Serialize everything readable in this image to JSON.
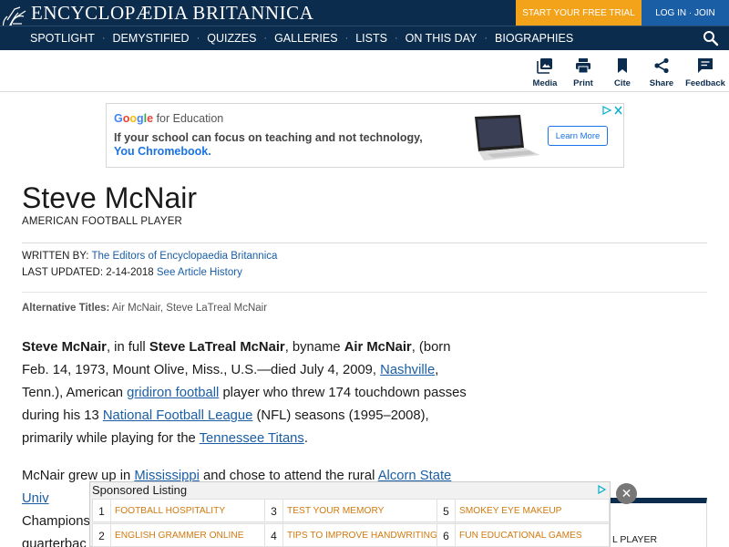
{
  "header": {
    "logo_text": "ENCYCLOPÆDIA BRITANNICA",
    "trial_label": "START YOUR FREE TRIAL",
    "login_label": "LOG IN · JOIN"
  },
  "nav": {
    "items": [
      "SPOTLIGHT",
      "DEMYSTIFIED",
      "QUIZZES",
      "GALLERIES",
      "LISTS",
      "ON THIS DAY",
      "BIOGRAPHIES"
    ],
    "separator": "·"
  },
  "toolbar": {
    "media": "Media",
    "print": "Print",
    "cite": "Cite",
    "share": "Share",
    "feedback": "Feedback"
  },
  "ad": {
    "brand_google": "Google",
    "brand_suffix": "for Education",
    "line1": "If your school can focus on teaching and not technology,",
    "line2": "You Chromebook.",
    "cta": "Learn More"
  },
  "article": {
    "title": "Steve McNair",
    "subtitle": "AMERICAN FOOTBALL PLAYER",
    "written_by_label": "WRITTEN BY:",
    "written_by": "The Editors of Encyclopaedia Britannica",
    "updated_label": "LAST UPDATED:",
    "updated_date": "2-14-2018",
    "history_link": "See Article History",
    "alt_label": "Alternative Titles:",
    "alt_titles": "Air McNair, Steve LaTreal McNair",
    "p1": {
      "name": "Steve McNair",
      "t1": ", in full ",
      "full_name": "Steve LaTreal McNair",
      "t2": ", byname ",
      "byname": "Air McNair",
      "t3": ", (born Feb. 14, 1973, Mount Olive, Miss., U.S.—died July 4, 2009, ",
      "link1": "Nashville",
      "t4": ", Tenn.), American ",
      "link2": "gridiron football",
      "t5": " player who threw 174 touchdown passes during his 13 ",
      "link3": "National Football League",
      "t6": " (NFL) seasons (1995–2008), primarily while playing for the ",
      "link4": "Tennessee Titans",
      "t7": "."
    },
    "p2": {
      "t1": "McNair grew up in ",
      "link1": "Mississippi",
      "t2": " and chose to attend the rural ",
      "link2": "Alcorn State Univ",
      "t3": " Champions",
      "t4": " quarterbac"
    }
  },
  "sidecard": {
    "text": "L PLAYER"
  },
  "sponsored": {
    "title": "Sponsored Listing",
    "items": [
      {
        "num": "1",
        "label": "FOOTBALL HOSPITALITY"
      },
      {
        "num": "2",
        "label": "ENGLISH GRAMMER ONLINE"
      },
      {
        "num": "3",
        "label": "TEST YOUR MEMORY"
      },
      {
        "num": "4",
        "label": "TIPS TO IMPROVE HANDWRITING"
      },
      {
        "num": "5",
        "label": "SMOKEY EYE MAKEUP"
      },
      {
        "num": "6",
        "label": "FUN EDUCATIONAL GAMES"
      }
    ],
    "close": "✕"
  },
  "colors": {
    "navy": "#0c2c4e",
    "trial_orange": "#f2a31a",
    "login_blue": "#1a5ea6",
    "link_blue": "#1a5ea6",
    "sponsor_orange": "#d07a10"
  }
}
